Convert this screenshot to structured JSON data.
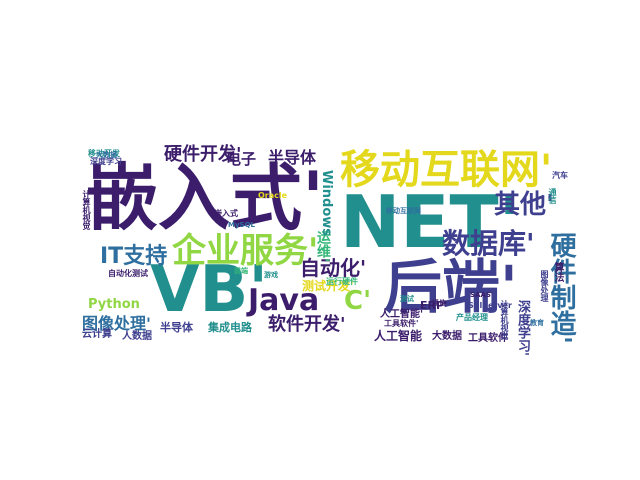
{
  "wordcloud": {
    "colors": {
      "dark_purple": "#3b1d6b",
      "indigo": "#3f3f8f",
      "blue": "#2f6f9f",
      "teal": "#218f8d",
      "green": "#35b779",
      "lime": "#90d743",
      "yellow": "#e4d81c"
    },
    "words": [
      {
        "text": "嵌入式'",
        "color": "#3b1d6b"
      },
      {
        "text": "NET'",
        "color": "#218f8d"
      },
      {
        "text": "移动互联网'",
        "color": "#e4d81c"
      },
      {
        "text": "后端'",
        "color": "#3f3f8f"
      },
      {
        "text": "VB'",
        "color": "#218f8d"
      },
      {
        "text": "企业服务'",
        "color": "#90d743"
      },
      {
        "text": "Java",
        "color": "#3b1d6b"
      },
      {
        "text": "C'",
        "color": "#90d743"
      },
      {
        "text": "其他'",
        "color": "#3f3f8f"
      },
      {
        "text": "数据库'",
        "color": "#3f3f8f"
      },
      {
        "text": "IT支持",
        "color": "#2f6f9f"
      },
      {
        "text": "硬件制造'",
        "color": "#2f6f9f"
      },
      {
        "text": "硬件开发'",
        "color": "#3b1d6b"
      },
      {
        "text": "电子",
        "color": "#3b1d6b"
      },
      {
        "text": "半导体",
        "color": "#3b1d6b"
      },
      {
        "text": "自动化'",
        "color": "#3b1d6b"
      },
      {
        "text": "图像处理'",
        "color": "#2f6f9f"
      },
      {
        "text": "软件开发'",
        "color": "#3b1d6b"
      },
      {
        "text": "Python",
        "color": "#90d743"
      },
      {
        "text": "运维'",
        "color": "#35b779"
      },
      {
        "text": "Windows",
        "color": "#218f8d"
      },
      {
        "text": "测试开发'",
        "color": "#e4d81c"
      },
      {
        "text": "半导体",
        "color": "#3f3f8f"
      },
      {
        "text": "集成电路",
        "color": "#218f8d"
      },
      {
        "text": "人工智能",
        "color": "#3b1d6b"
      },
      {
        "text": "大数据",
        "color": "#3b1d6b"
      },
      {
        "text": "工具软件",
        "color": "#3b1d6b"
      },
      {
        "text": "深度学习'",
        "color": "#3f3f8f"
      },
      {
        "text": "云计算",
        "color": "#3f3f8f"
      },
      {
        "text": "人数据",
        "color": "#3f3f8f"
      },
      {
        "text": "ERP'",
        "color": "#3b1d6b"
      },
      {
        "text": "人工智能'",
        "color": "#3b1d6b"
      },
      {
        "text": "运行硬件",
        "color": "#35b779"
      },
      {
        "text": "计算机视觉",
        "color": "#3b1d6b"
      },
      {
        "text": "深度学习",
        "color": "#3f3f8f"
      },
      {
        "text": "移动开发",
        "color": "#218f8d"
      },
      {
        "text": "产品经理",
        "color": "#218f8d"
      },
      {
        "text": "SqlServer",
        "color": "#3f3f8f"
      },
      {
        "text": "工具软件'",
        "color": "#3b1d6b"
      },
      {
        "text": "大数据",
        "color": "#2f6f9f"
      },
      {
        "text": "通信",
        "color": "#218f8d"
      },
      {
        "text": "图像处理",
        "color": "#3f3f8f"
      },
      {
        "text": "计算机视觉",
        "color": "#3f3f8f"
      },
      {
        "text": "自动化测试",
        "color": "#3b1d6b"
      },
      {
        "text": "Oracle",
        "color": "#e4d81c"
      },
      {
        "text": "算法",
        "color": "#3b1d6b"
      },
      {
        "text": "嵌入式",
        "color": "#3b1d6b"
      },
      {
        "text": "MySQL",
        "color": "#2f6f9f"
      },
      {
        "text": "汽车",
        "color": "#3f3f8f"
      },
      {
        "text": "前端",
        "color": "#35b779"
      },
      {
        "text": "移动互联网",
        "color": "#2f6f9f"
      },
      {
        "text": "通信",
        "color": "#3b1d6b"
      },
      {
        "text": "游戏",
        "color": "#218f8d"
      },
      {
        "text": "SAAS'",
        "color": "#3b1d6b"
      },
      {
        "text": "测试",
        "color": "#218f8d"
      },
      {
        "text": "教育",
        "color": "#2f6f9f"
      }
    ]
  }
}
